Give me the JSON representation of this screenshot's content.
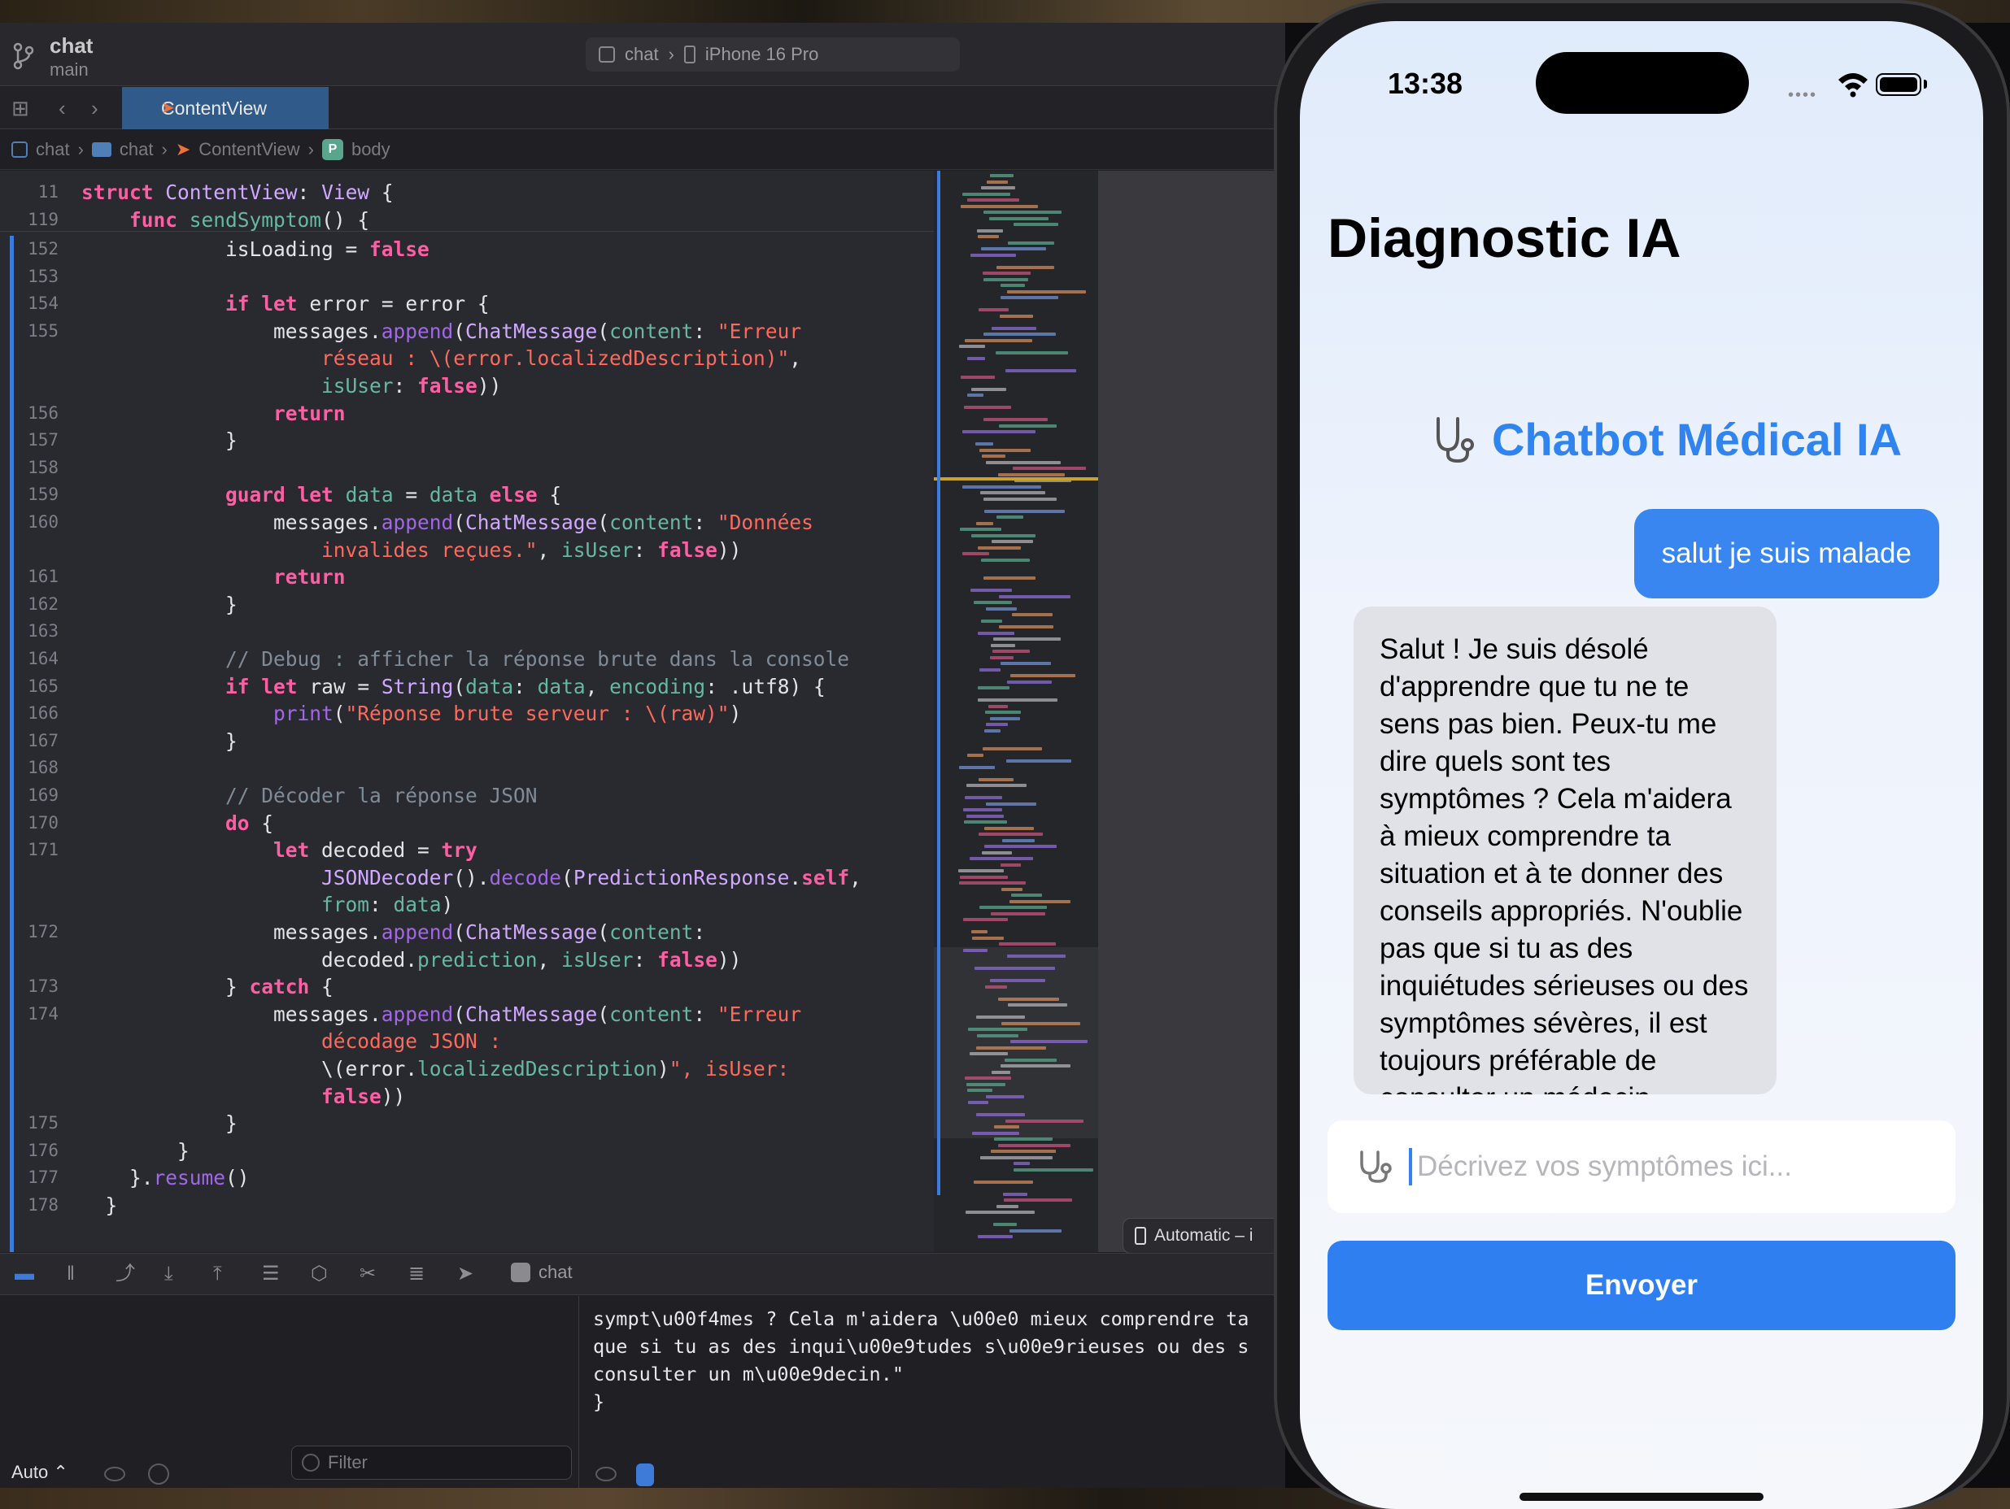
{
  "xcode": {
    "project_name": "chat",
    "branch": "main",
    "scheme": "chat",
    "destination": "iPhone 16 Pro",
    "active_tab": "ContentView",
    "breadcrumb": [
      "chat",
      "chat",
      "ContentView",
      "body"
    ],
    "sticky_lines": [
      {
        "num": "11",
        "text": "struct ContentView: View {"
      },
      {
        "num": "119",
        "text": "    func sendSymptom() {"
      }
    ],
    "code_lines": [
      {
        "num": "152",
        "text": "            isLoading = false"
      },
      {
        "num": "153",
        "text": ""
      },
      {
        "num": "154",
        "text": "            if let error = error {"
      },
      {
        "num": "155",
        "text": "                messages.append(ChatMessage(content: \"Erreur"
      },
      {
        "num": "",
        "text": "                    réseau : \\(error.localizedDescription)\","
      },
      {
        "num": "",
        "text": "                    isUser: false))"
      },
      {
        "num": "156",
        "text": "                return"
      },
      {
        "num": "157",
        "text": "            }"
      },
      {
        "num": "158",
        "text": ""
      },
      {
        "num": "159",
        "text": "            guard let data = data else {"
      },
      {
        "num": "160",
        "text": "                messages.append(ChatMessage(content: \"Données"
      },
      {
        "num": "",
        "text": "                    invalides reçues.\", isUser: false))"
      },
      {
        "num": "161",
        "text": "                return"
      },
      {
        "num": "162",
        "text": "            }"
      },
      {
        "num": "163",
        "text": ""
      },
      {
        "num": "164",
        "text": "            // Debug : afficher la réponse brute dans la console"
      },
      {
        "num": "165",
        "text": "            if let raw = String(data: data, encoding: .utf8) {"
      },
      {
        "num": "166",
        "text": "                print(\"Réponse brute serveur : \\(raw)\")"
      },
      {
        "num": "167",
        "text": "            }"
      },
      {
        "num": "168",
        "text": ""
      },
      {
        "num": "169",
        "text": "            // Décoder la réponse JSON"
      },
      {
        "num": "170",
        "text": "            do {"
      },
      {
        "num": "171",
        "text": "                let decoded = try"
      },
      {
        "num": "",
        "text": "                    JSONDecoder().decode(PredictionResponse.self,"
      },
      {
        "num": "",
        "text": "                    from: data)"
      },
      {
        "num": "172",
        "text": "                messages.append(ChatMessage(content:"
      },
      {
        "num": "",
        "text": "                    decoded.prediction, isUser: false))"
      },
      {
        "num": "173",
        "text": "            } catch {"
      },
      {
        "num": "174",
        "text": "                messages.append(ChatMessage(content: \"Erreur"
      },
      {
        "num": "",
        "text": "                    décodage JSON :"
      },
      {
        "num": "",
        "text": "                    \\(error.localizedDescription)\", isUser:"
      },
      {
        "num": "",
        "text": "                    false))"
      },
      {
        "num": "175",
        "text": "            }"
      },
      {
        "num": "176",
        "text": "        }"
      },
      {
        "num": "177",
        "text": "    }.resume()"
      },
      {
        "num": "178",
        "text": "  }"
      }
    ],
    "preview_device": "Automatic – i",
    "debug_target": "chat",
    "console_lines": [
      "sympt\\u00f4mes ? Cela m'aidera \\u00e0 mieux comprendre ta",
      "que si tu as des inqui\\u00e9tudes s\\u00e9rieuses ou des s",
      "consulter un m\\u00e9decin.\"",
      "}"
    ],
    "console_scope": "Auto ⌃",
    "filter_placeholder": "Filter"
  },
  "phone": {
    "time": "13:38",
    "nav_title": "Diagnostic IA",
    "chat_title": "Chatbot Médical IA",
    "user_message": "salut je suis malade",
    "bot_message": "Salut ! Je suis désolé d'apprendre que tu ne te sens pas bien. Peux-tu me dire quels sont tes symptômes ? Cela m'aidera à mieux comprendre ta situation et à te donner des conseils appropriés. N'oublie pas que si tu as des inquiétudes sérieuses ou des symptômes sévères, il est toujours préférable de consulter un médecin.",
    "input_placeholder": "Décrivez vos symptômes ici...",
    "send_label": "Envoyer"
  },
  "colors": {
    "accent_blue": "#2f84ef",
    "keyword_pink": "#fc5fa3",
    "string_red": "#fc6a5d",
    "type_purple": "#d0a8ff"
  }
}
